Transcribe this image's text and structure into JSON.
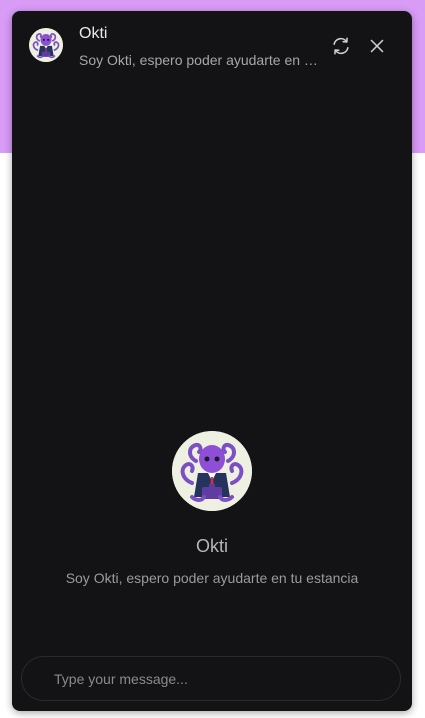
{
  "header": {
    "title": "Okti",
    "subtitle": "Soy Okti, espero poder ayudarte en tu estancia",
    "avatar_icon": "octopus-businessman-icon",
    "refresh_icon": "refresh-icon",
    "close_icon": "close-icon"
  },
  "welcome": {
    "name": "Okti",
    "description": "Soy Okti, espero poder ayudarte en tu estancia",
    "avatar_icon": "octopus-businessman-icon"
  },
  "composer": {
    "placeholder": "Type your message...",
    "value": ""
  },
  "colors": {
    "background_accent": "#d89bf6",
    "panel": "#131315",
    "octopus": "#8e4fd6"
  }
}
